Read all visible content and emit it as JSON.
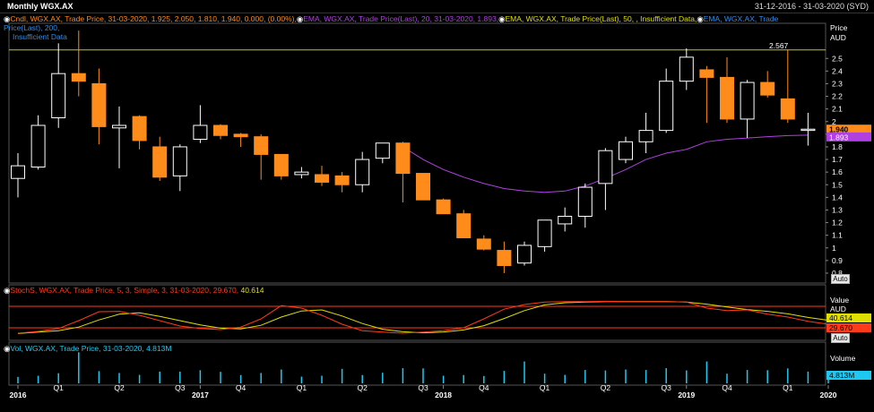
{
  "header": {
    "title": "Monthly WGX.AX",
    "date_range": "31-12-2016 - 31-03-2020 (SYD)"
  },
  "legends": {
    "candle": "Cndl, WGX.AX, Trade Price, 31-03-2020, 1.925, 2.050, 1.810, 1.940, 0.000, (0.00%),",
    "ema20": "EMA, WGX.AX, Trade Price(Last), 20, 31-03-2020, 1.893,",
    "ema50": "EMA, WGX.AX, Trade Price(Last), 50, , Insufficient Data,",
    "ema200": "EMA, WGX.AX, Trade Price(Last), 200,",
    "ema200_cont": "Insufficient Data",
    "stoch": "StochS, WGX.AX, Trade Price, 5, 3, Simple, 3, 31-03-2020, 29.670,",
    "stoch_val2": "40.614",
    "vol": "Vol, WGX.AX, Trade Price, 31-03-2020, 4.813M"
  },
  "axis": {
    "price_title": "Price",
    "price_unit": "AUD",
    "value_title": "Value",
    "value_unit": "AUD",
    "volume_title": "Volume",
    "auto_label": "Auto"
  },
  "price_labels": {
    "last": "1.940",
    "ema": "1.893",
    "hline": "2.567"
  },
  "stoch_labels": {
    "d": "40.614",
    "k": "29.670"
  },
  "vol_label": "4.813M",
  "colors": {
    "up": "#ffffff",
    "candle": "#ff8c1a",
    "ema": "#b040e0",
    "hline": "#c8c800",
    "stoch_k": "#ff3a1a",
    "stoch_d": "#e0e000",
    "stoch_band": "#ff3a1a",
    "volume": "#1ec8f0",
    "grid_text": "#ffffff"
  },
  "chart_data": {
    "type": "candlestick",
    "price_axis": {
      "ylim": [
        0.75,
        2.75
      ],
      "ticks": [
        0.8,
        0.9,
        1,
        1.1,
        1.2,
        1.3,
        1.4,
        1.5,
        1.6,
        1.7,
        1.8,
        1.9,
        2,
        2.1,
        2.2,
        2.3,
        2.4,
        2.5
      ],
      "tick_labels": [
        "0.8",
        "0.9",
        "1",
        "1.1",
        "1.2",
        "1.3",
        "1.4",
        "1.5",
        "1.6",
        "1.7",
        "1.8",
        "1.9",
        "2",
        "2.1",
        "2.2",
        "2.3",
        "2.4",
        "2.5"
      ]
    },
    "x_tick_labels": [
      {
        "i": 0,
        "label": "2016",
        "bold": true
      },
      {
        "i": 2,
        "label": "Q1"
      },
      {
        "i": 5,
        "label": "Q2"
      },
      {
        "i": 8,
        "label": "Q3"
      },
      {
        "i": 9,
        "label": "2017",
        "bold": true
      },
      {
        "i": 11,
        "label": "Q4"
      },
      {
        "i": 14,
        "label": "Q1"
      },
      {
        "i": 17,
        "label": "Q2"
      },
      {
        "i": 20,
        "label": "Q3"
      },
      {
        "i": 21,
        "label": "2018",
        "bold": true
      },
      {
        "i": 23,
        "label": "Q4"
      },
      {
        "i": 26,
        "label": "Q1"
      },
      {
        "i": 29,
        "label": "Q2"
      },
      {
        "i": 32,
        "label": "Q3"
      },
      {
        "i": 33,
        "label": "2019",
        "bold": true
      },
      {
        "i": 35,
        "label": "Q4"
      },
      {
        "i": 38,
        "label": "Q1"
      },
      {
        "i": 40,
        "label": "2020",
        "bold": true
      }
    ],
    "horizontal_line": 2.567,
    "candles": [
      {
        "o": 1.55,
        "h": 1.75,
        "l": 1.4,
        "c": 1.65
      },
      {
        "o": 1.64,
        "h": 2.05,
        "l": 1.62,
        "c": 1.97
      },
      {
        "o": 2.03,
        "h": 2.62,
        "l": 1.95,
        "c": 2.38
      },
      {
        "o": 2.38,
        "h": 2.72,
        "l": 2.2,
        "c": 2.32
      },
      {
        "o": 2.3,
        "h": 2.42,
        "l": 1.82,
        "c": 1.96
      },
      {
        "o": 1.95,
        "h": 2.12,
        "l": 1.63,
        "c": 1.97
      },
      {
        "o": 2.04,
        "h": 2.05,
        "l": 1.78,
        "c": 1.85
      },
      {
        "o": 1.8,
        "h": 1.88,
        "l": 1.53,
        "c": 1.56
      },
      {
        "o": 1.57,
        "h": 1.82,
        "l": 1.45,
        "c": 1.8
      },
      {
        "o": 1.86,
        "h": 2.13,
        "l": 1.83,
        "c": 1.97
      },
      {
        "o": 1.97,
        "h": 1.98,
        "l": 1.86,
        "c": 1.89
      },
      {
        "o": 1.9,
        "h": 1.91,
        "l": 1.8,
        "c": 1.88
      },
      {
        "o": 1.88,
        "h": 1.9,
        "l": 1.54,
        "c": 1.74
      },
      {
        "o": 1.74,
        "h": 1.74,
        "l": 1.54,
        "c": 1.57
      },
      {
        "o": 1.58,
        "h": 1.64,
        "l": 1.55,
        "c": 1.6
      },
      {
        "o": 1.58,
        "h": 1.65,
        "l": 1.49,
        "c": 1.52
      },
      {
        "o": 1.57,
        "h": 1.6,
        "l": 1.44,
        "c": 1.5
      },
      {
        "o": 1.5,
        "h": 1.76,
        "l": 1.44,
        "c": 1.7
      },
      {
        "o": 1.71,
        "h": 1.83,
        "l": 1.67,
        "c": 1.83
      },
      {
        "o": 1.83,
        "h": 1.84,
        "l": 1.36,
        "c": 1.59
      },
      {
        "o": 1.59,
        "h": 1.59,
        "l": 1.38,
        "c": 1.38
      },
      {
        "o": 1.38,
        "h": 1.39,
        "l": 1.27,
        "c": 1.27
      },
      {
        "o": 1.27,
        "h": 1.3,
        "l": 1.08,
        "c": 1.08
      },
      {
        "o": 1.07,
        "h": 1.1,
        "l": 0.98,
        "c": 0.99
      },
      {
        "o": 0.98,
        "h": 1.05,
        "l": 0.8,
        "c": 0.86
      },
      {
        "o": 0.88,
        "h": 1.05,
        "l": 0.86,
        "c": 1.02
      },
      {
        "o": 1.01,
        "h": 1.22,
        "l": 0.97,
        "c": 1.22
      },
      {
        "o": 1.19,
        "h": 1.32,
        "l": 1.13,
        "c": 1.25
      },
      {
        "o": 1.25,
        "h": 1.51,
        "l": 1.16,
        "c": 1.48
      },
      {
        "o": 1.51,
        "h": 1.79,
        "l": 1.3,
        "c": 1.77
      },
      {
        "o": 1.7,
        "h": 1.88,
        "l": 1.67,
        "c": 1.84
      },
      {
        "o": 1.84,
        "h": 2.07,
        "l": 1.75,
        "c": 1.93
      },
      {
        "o": 1.93,
        "h": 2.42,
        "l": 1.91,
        "c": 2.32
      },
      {
        "o": 2.32,
        "h": 2.58,
        "l": 2.25,
        "c": 2.51
      },
      {
        "o": 2.41,
        "h": 2.44,
        "l": 1.99,
        "c": 2.35
      },
      {
        "o": 2.35,
        "h": 2.51,
        "l": 1.99,
        "c": 2.02
      },
      {
        "o": 2.02,
        "h": 2.33,
        "l": 1.87,
        "c": 2.31
      },
      {
        "o": 2.31,
        "h": 2.4,
        "l": 2.19,
        "c": 2.21
      },
      {
        "o": 2.18,
        "h": 2.57,
        "l": 1.99,
        "c": 2.02
      },
      {
        "o": 1.93,
        "h": 2.07,
        "l": 1.81,
        "c": 1.94
      }
    ],
    "ema20": [
      1.8,
      1.7,
      1.62,
      1.56,
      1.51,
      1.47,
      1.45,
      1.44,
      1.45,
      1.49,
      1.55,
      1.62,
      1.7,
      1.75,
      1.78,
      1.84,
      1.86,
      1.87,
      1.88,
      1.889,
      1.893
    ],
    "ema20_start_index": 19,
    "stoch_axis": {
      "ylim": [
        0,
        100
      ],
      "bands": [
        20,
        80
      ]
    },
    "stoch_k": [
      5,
      10,
      18,
      40,
      65,
      66,
      55,
      40,
      25,
      18,
      15,
      22,
      45,
      82,
      75,
      55,
      30,
      12,
      8,
      5,
      8,
      12,
      20,
      45,
      72,
      85,
      92,
      93,
      93,
      94,
      93,
      93,
      93,
      92,
      75,
      68,
      70,
      58,
      50,
      38,
      30
    ],
    "stoch_d": [
      4,
      8,
      12,
      22,
      42,
      58,
      62,
      52,
      40,
      28,
      19,
      17,
      27,
      50,
      67,
      70,
      53,
      32,
      16,
      9,
      6,
      8,
      14,
      26,
      46,
      68,
      84,
      90,
      92,
      93,
      93,
      93,
      93,
      92,
      86,
      78,
      71,
      66,
      59,
      49,
      41
    ],
    "volume": [
      2.8,
      3.3,
      4.4,
      13.5,
      5.3,
      4.5,
      3.7,
      5.1,
      5.1,
      5.7,
      5.0,
      3.6,
      4.5,
      6.0,
      2.9,
      3.3,
      6.3,
      3.6,
      4.6,
      6.6,
      6.5,
      3.3,
      3.6,
      3.2,
      5.4,
      9.5,
      4.2,
      3.7,
      5.8,
      5.6,
      6.0,
      5.8,
      6.6,
      5.6,
      9.5,
      4.2,
      5.8,
      5.7,
      6.5,
      5.1,
      4.8
    ]
  }
}
